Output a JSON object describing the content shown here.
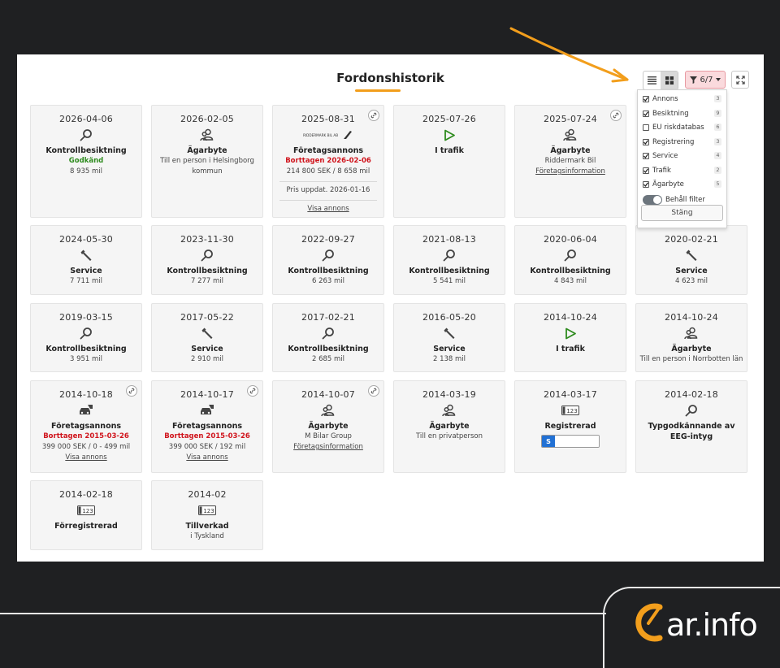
{
  "page": {
    "title": "Fordonshistorik"
  },
  "toolbar": {
    "filter_label": "6/7"
  },
  "filter_popup": {
    "options": [
      {
        "label": "Annons",
        "checked": true,
        "count": "3"
      },
      {
        "label": "Besiktning",
        "checked": true,
        "count": "9"
      },
      {
        "label": "EU riskdatabas",
        "checked": false,
        "count": "6"
      },
      {
        "label": "Registrering",
        "checked": true,
        "count": "3"
      },
      {
        "label": "Service",
        "checked": true,
        "count": "4"
      },
      {
        "label": "Trafik",
        "checked": true,
        "count": "2"
      },
      {
        "label": "Ägarbyte",
        "checked": true,
        "count": "5"
      }
    ],
    "keep_filter_label": "Behåll filter",
    "close_label": "Stäng"
  },
  "cards": [
    {
      "date": "2026-04-06",
      "icon": "magnifier-icon",
      "title": "Kontrollbesiktning",
      "lines": [
        {
          "text": "Godkänd",
          "style": "green"
        },
        {
          "text": "8 935 mil"
        }
      ]
    },
    {
      "date": "2026-02-05",
      "icon": "owner-change-icon",
      "title": "Ägarbyte",
      "lines": [
        {
          "text": "Till en person i Helsingborg"
        },
        {
          "text": "kommun"
        }
      ]
    },
    {
      "date": "2025-08-31",
      "icon": "dealer-logo-icon",
      "logo_text": "RIDDERMARK BIL AB",
      "title": "Företagsannons",
      "corner_link": true,
      "lines": [
        {
          "text": "Borttagen 2026-02-06",
          "style": "red"
        },
        {
          "text": "214 800 SEK / 8 658 mil"
        },
        {
          "sep": true
        },
        {
          "text": "Pris uppdat. 2026-01-16"
        },
        {
          "sep": true
        },
        {
          "text": "Visa annons",
          "style": "link"
        }
      ]
    },
    {
      "date": "2025-07-26",
      "icon": "play-icon",
      "title": "I trafik",
      "lines": []
    },
    {
      "date": "2025-07-24",
      "icon": "owner-change-icon",
      "title": "Ägarbyte",
      "corner_link": true,
      "lines": [
        {
          "text": "Riddermark Bil"
        },
        {
          "text": "Företagsinformation",
          "style": "link"
        }
      ]
    },
    {
      "date": "2024-05-30",
      "icon": "wrench-icon",
      "title": "Service",
      "lines": [
        {
          "text": "7 711 mil"
        }
      ]
    },
    {
      "date": "2023-11-30",
      "icon": "magnifier-icon",
      "title": "Kontrollbesiktning",
      "lines": [
        {
          "text": "7 277 mil"
        }
      ]
    },
    {
      "date": "2022-09-27",
      "icon": "magnifier-icon",
      "title": "Kontrollbesiktning",
      "lines": [
        {
          "text": "6 263 mil"
        }
      ]
    },
    {
      "date": "2021-08-13",
      "icon": "magnifier-icon",
      "title": "Kontrollbesiktning",
      "lines": [
        {
          "text": "5 541 mil"
        }
      ]
    },
    {
      "date": "2020-06-04",
      "icon": "magnifier-icon",
      "title": "Kontrollbesiktning",
      "lines": [
        {
          "text": "4 843 mil"
        }
      ]
    },
    {
      "date": "2020-02-21",
      "icon": "wrench-icon",
      "title": "Service",
      "lines": [
        {
          "text": "4 623 mil"
        }
      ]
    },
    {
      "date": "2019-03-15",
      "icon": "magnifier-icon",
      "title": "Kontrollbesiktning",
      "lines": [
        {
          "text": "3 951 mil"
        }
      ]
    },
    {
      "date": "2017-05-22",
      "icon": "wrench-icon",
      "title": "Service",
      "lines": [
        {
          "text": "2 910 mil"
        }
      ]
    },
    {
      "date": "2017-02-21",
      "icon": "magnifier-icon",
      "title": "Kontrollbesiktning",
      "lines": [
        {
          "text": "2 685 mil"
        }
      ]
    },
    {
      "date": "2016-05-20",
      "icon": "wrench-icon",
      "title": "Service",
      "lines": [
        {
          "text": "2 138 mil"
        }
      ]
    },
    {
      "date": "2014-10-24",
      "icon": "play-icon",
      "title": "I trafik",
      "lines": []
    },
    {
      "date": "2014-10-24",
      "icon": "owner-change-icon",
      "title": "Ägarbyte",
      "lines": [
        {
          "text": "Till en person i Norrbotten län"
        }
      ]
    },
    {
      "date": "2014-10-18",
      "icon": "car-ad-icon",
      "title": "Företagsannons",
      "corner_link": true,
      "lines": [
        {
          "text": "Borttagen 2015-03-26",
          "style": "red"
        },
        {
          "text": "399 000 SEK / 0 - 499 mil"
        },
        {
          "text": "Visa annons",
          "style": "link"
        }
      ]
    },
    {
      "date": "2014-10-17",
      "icon": "car-ad-icon",
      "title": "Företagsannons",
      "corner_link": true,
      "lines": [
        {
          "text": "Borttagen 2015-03-26",
          "style": "red"
        },
        {
          "text": "399 000 SEK / 192 mil"
        },
        {
          "text": "Visa annons",
          "style": "link"
        }
      ]
    },
    {
      "date": "2014-10-07",
      "icon": "owner-change-icon",
      "title": "Ägarbyte",
      "corner_link": true,
      "lines": [
        {
          "text": "M Bilar Group"
        },
        {
          "text": "Företagsinformation",
          "style": "link"
        }
      ]
    },
    {
      "date": "2014-03-19",
      "icon": "owner-change-icon",
      "title": "Ägarbyte",
      "lines": [
        {
          "text": "Till en privatperson"
        }
      ]
    },
    {
      "date": "2014-03-17",
      "icon": "license-plate-icon",
      "plate_text": "123",
      "title": "Registrerad",
      "reg_bar": "S",
      "lines": []
    },
    {
      "date": "2014-02-18",
      "icon": "magnifier-icon",
      "title": "Typgodkännande av EEG-intyg",
      "lines": []
    },
    {
      "date": "2014-02-18",
      "icon": "license-plate-icon",
      "plate_text": "123",
      "title": "Förregistrerad",
      "lines": []
    },
    {
      "date": "2014-02",
      "icon": "license-plate-icon",
      "plate_text": "123",
      "title": "Tillverkad",
      "lines": [
        {
          "text": "i Tyskland"
        }
      ]
    }
  ],
  "brand": {
    "logo_text": "ar.info",
    "logo_letter": "C",
    "accent": "#f29e1c"
  }
}
